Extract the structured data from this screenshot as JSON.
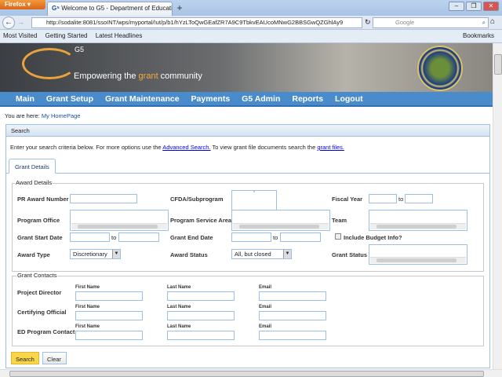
{
  "browser": {
    "menu_button": "Firefox",
    "tab_title": "Welcome to G5 - Department of Educati...",
    "new_tab": "+",
    "url": "http://sodalite:8081/ssoINT/wps/myportal/!ut/p/b1/hYzLToQwGEafZR7A9C9TbkvEAUcoMNwG2BBSGwQZGhlAy9",
    "search_placeholder": "Google",
    "bookmarks": [
      "Most Visited",
      "Getting Started",
      "Latest Headlines"
    ],
    "bookmarks_menu": "Bookmarks"
  },
  "banner": {
    "logo": "G5",
    "tagline_pre": "Empowering the ",
    "tagline_accent": "grant",
    "tagline_post": " community",
    "seal_text": "Department of Education"
  },
  "menu": [
    "Main",
    "Grant Setup",
    "Grant Maintenance",
    "Payments",
    "G5 Admin",
    "Reports",
    "Logout"
  ],
  "breadcrumb": {
    "prefix": "You are here:",
    "page": "My HomePage"
  },
  "panel": {
    "title": "Search",
    "intro_1": "Enter your search criteria below. For more options use the ",
    "link_advanced": "Advanced Search.",
    "intro_2": " To view grant file documents search the ",
    "link_files": "grant files.",
    "tab": "Grant Details"
  },
  "award": {
    "legend": "Award Details",
    "pr_award_number": "PR Award Number",
    "cfda": "CFDA/Subprogram",
    "cfda_value": "'",
    "fiscal_year": "Fiscal Year",
    "to": "to",
    "program_office": "Program Office",
    "program_service_area": "Program Service Area",
    "team": "Team",
    "grant_start_date": "Grant Start Date",
    "grant_end_date": "Grant End Date",
    "include_budget": "Include Budget Info?",
    "award_type": "Award Type",
    "award_type_value": "Discretionary",
    "award_status": "Award Status",
    "award_status_value": "All, but closed",
    "grant_status": "Grant Status"
  },
  "contacts": {
    "legend": "Grant Contacts",
    "first_name": "First Name",
    "last_name": "Last Name",
    "email": "Email",
    "rows": [
      "Project Director",
      "Certifying Official",
      "ED Program Contact"
    ]
  },
  "buttons": {
    "search": "Search",
    "clear": "Clear"
  },
  "colors": {
    "menu": "#4a8ccb",
    "accent": "#f6a93b",
    "search_button": "#f8d54a",
    "border": "#9cc0e6"
  }
}
